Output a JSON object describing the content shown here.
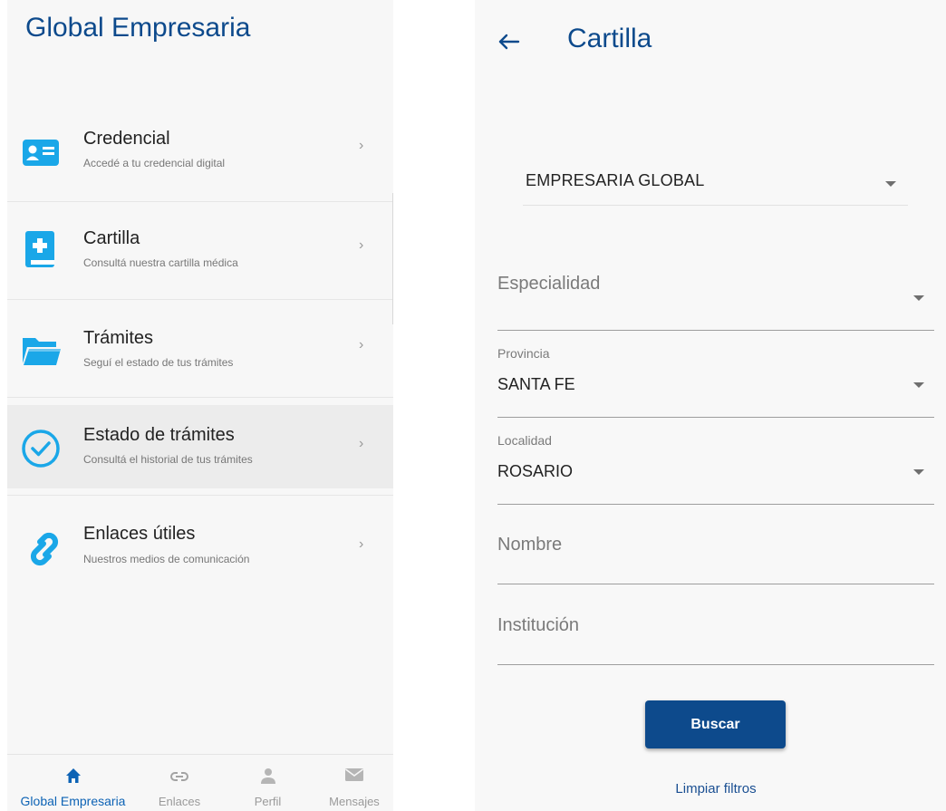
{
  "left": {
    "app_title": "Global Empresaria",
    "menu": [
      {
        "title": "Credencial",
        "subtitle": "Accedé a tu credencial digital",
        "icon": "id-card-icon"
      },
      {
        "title": "Cartilla",
        "subtitle": "Consultá nuestra cartilla médica",
        "icon": "medical-book-icon"
      },
      {
        "title": "Trámites",
        "subtitle": "Seguí el estado de tus trámites",
        "icon": "folder-icon"
      },
      {
        "title": "Estado de trámites",
        "subtitle": "Consultá el historial de tus trámites",
        "icon": "check-circle-icon"
      },
      {
        "title": "Enlaces útiles",
        "subtitle": "Nuestros medios de comunicación",
        "icon": "link-icon"
      }
    ],
    "bottom_nav": [
      {
        "label": "Global Empresaria",
        "icon": "home-icon",
        "active": true
      },
      {
        "label": "Enlaces",
        "icon": "link-icon",
        "active": false
      },
      {
        "label": "Perfil",
        "icon": "person-icon",
        "active": false
      },
      {
        "label": "Mensajes",
        "icon": "mail-icon",
        "active": false
      }
    ],
    "chevron": "›"
  },
  "right": {
    "title": "Cartilla",
    "plan_select": "EMPRESARIA GLOBAL",
    "especialidad": {
      "placeholder": "Especialidad"
    },
    "provincia": {
      "label": "Provincia",
      "value": "SANTA FE"
    },
    "localidad": {
      "label": "Localidad",
      "value": "ROSARIO"
    },
    "nombre": {
      "placeholder": "Nombre"
    },
    "institucion": {
      "placeholder": "Institución"
    },
    "buscar_label": "Buscar",
    "limpiar_label": "Limpiar filtros"
  },
  "colors": {
    "primary": "#0d4a8c",
    "accent_icon": "#1aa7e8",
    "nav_active": "#0d63b5"
  }
}
